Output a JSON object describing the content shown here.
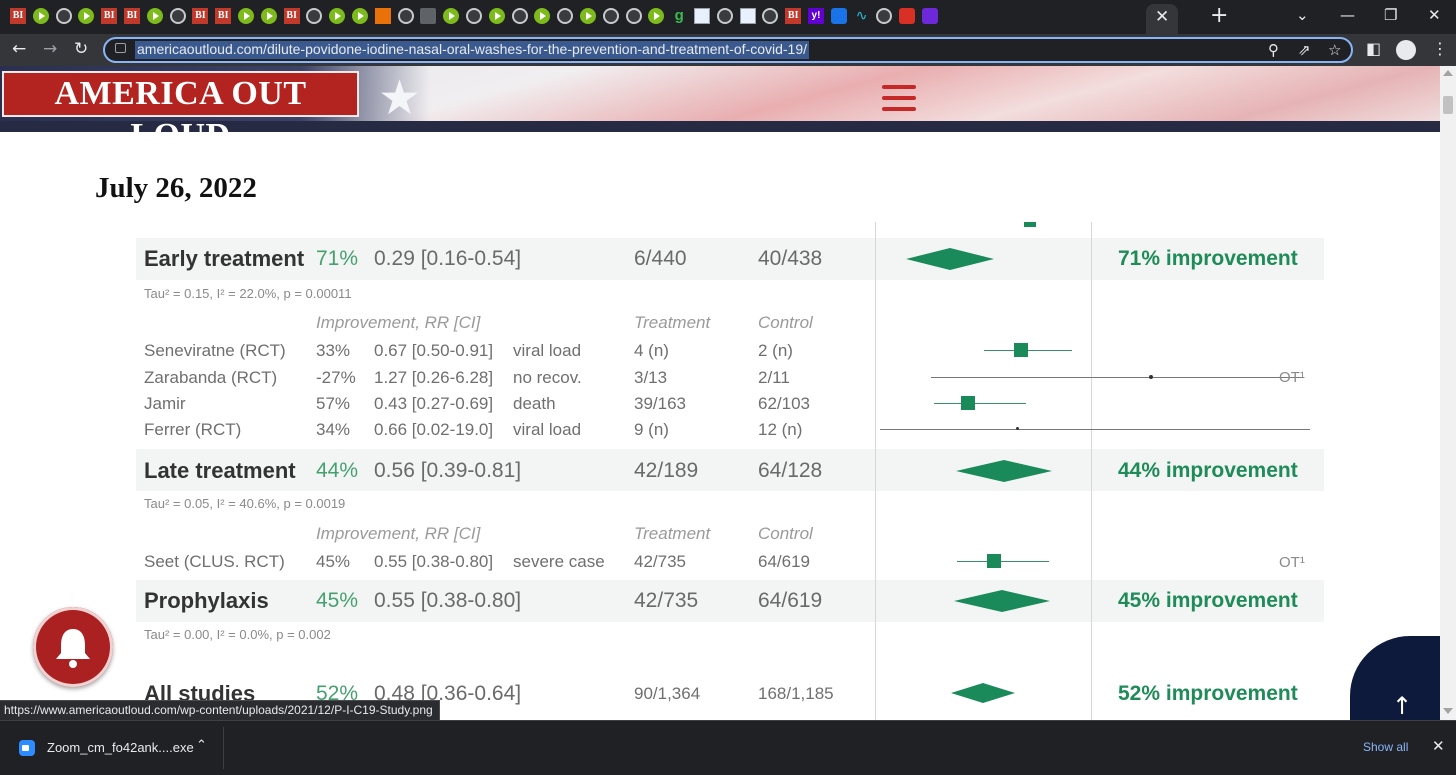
{
  "browser": {
    "tab_icons": [
      "bi",
      "play",
      "globe",
      "play",
      "bi",
      "bi",
      "play",
      "globe",
      "bi",
      "bi",
      "play",
      "play",
      "bi",
      "globe",
      "play",
      "play",
      "orange",
      "globe",
      "grey",
      "play",
      "globe",
      "play",
      "globe",
      "play",
      "globe",
      "play",
      "globe",
      "globe",
      "play",
      "g",
      "sq",
      "globe",
      "sq",
      "globe",
      "bi",
      "y",
      "blue",
      "wave",
      "globe",
      "red",
      "purple"
    ],
    "tab_bi_label": "BI",
    "tab_g_label": "g",
    "tab_y_label": "y!",
    "active_tab_close": "✕",
    "new_tab": "+",
    "window_controls": {
      "dropdown": "⌄",
      "minimize": "—",
      "restore": "❐",
      "close": "✕"
    },
    "url": "americaoutloud.com/dilute-povidone-iodine-nasal-oral-washes-for-the-prevention-and-treatment-of-covid-19/",
    "nav": {
      "back": "←",
      "forward": "→",
      "reload": "↻"
    },
    "toolbar_icons": {
      "zoom": "⚲",
      "share": "⇗",
      "bookmark": "☆",
      "sidepanel": "◧",
      "menu": "⋮"
    }
  },
  "site": {
    "logo": "AMERICA OUT LOUD",
    "star": "★",
    "colors": {
      "brand_red": "#b3231f",
      "navy": "#262a43"
    }
  },
  "article": {
    "date": "July 26, 2022"
  },
  "forest_plot": {
    "groups": [
      {
        "name": "Early treatment",
        "pct": "71%",
        "rr": "0.29 [0.16-0.54]",
        "treatment": "6/440",
        "control": "40/438",
        "improvement": "71% improvement",
        "het": "Tau² = 0.15, I² = 22.0%, p = 0.00011",
        "col_headers": {
          "improvement": "Improvement, RR [CI]",
          "treatment": "Treatment",
          "control": "Control"
        },
        "studies": [
          {
            "name": "Seneviratne (RCT)",
            "pct": "33%",
            "rr": "0.67 [0.50-0.91]",
            "outcome": "viral load",
            "treatment": "4 (n)",
            "control": "2 (n)",
            "ot": ""
          },
          {
            "name": "Zarabanda (RCT)",
            "pct": "-27%",
            "rr": "1.27 [0.26-6.28]",
            "outcome": "no recov.",
            "treatment": "3/13",
            "control": "2/11",
            "ot": "OT¹"
          },
          {
            "name": "Jamir",
            "pct": "57%",
            "rr": "0.43 [0.27-0.69]",
            "outcome": "death",
            "treatment": "39/163",
            "control": "62/103",
            "ot": ""
          },
          {
            "name": "Ferrer (RCT)",
            "pct": "34%",
            "rr": "0.66 [0.02-19.0]",
            "outcome": "viral load",
            "treatment": "9 (n)",
            "control": "12 (n)",
            "ot": ""
          }
        ]
      },
      {
        "name": "Late treatment",
        "pct": "44%",
        "rr": "0.56 [0.39-0.81]",
        "treatment": "42/189",
        "control": "64/128",
        "improvement": "44% improvement",
        "het": "Tau² = 0.05, I² = 40.6%, p = 0.0019",
        "col_headers": {
          "improvement": "Improvement, RR [CI]",
          "treatment": "Treatment",
          "control": "Control"
        },
        "studies": [
          {
            "name": "Seet (CLUS. RCT)",
            "pct": "45%",
            "rr": "0.55 [0.38-0.80]",
            "outcome": "severe case",
            "treatment": "42/735",
            "control": "64/619",
            "ot": "OT¹"
          }
        ]
      },
      {
        "name": "Prophylaxis",
        "pct": "45%",
        "rr": "0.55 [0.38-0.80]",
        "treatment": "42/735",
        "control": "64/619",
        "improvement": "45% improvement",
        "het": "Tau² = 0.00, I² = 0.0%, p = 0.002"
      }
    ],
    "all_studies": {
      "name": "All studies",
      "pct": "52%",
      "rr": "0.48 [0.36-0.64]",
      "treatment": "90/1,364",
      "control": "168/1,185",
      "improvement": "52% improvement"
    },
    "colors": {
      "estimate": "#1a8a5a",
      "improvement_text": "#1f8b58",
      "band": "#f2f5f3"
    }
  },
  "overlays": {
    "back_to_top": "↑",
    "status_url": "https://www.americaoutloud.com/wp-content/uploads/2021/12/P-I-C19-Study.png"
  },
  "downloads": {
    "file_name": "Zoom_cm_fo42ank....exe",
    "chevron": "⌃",
    "show_all": "Show all",
    "close": "✕"
  }
}
